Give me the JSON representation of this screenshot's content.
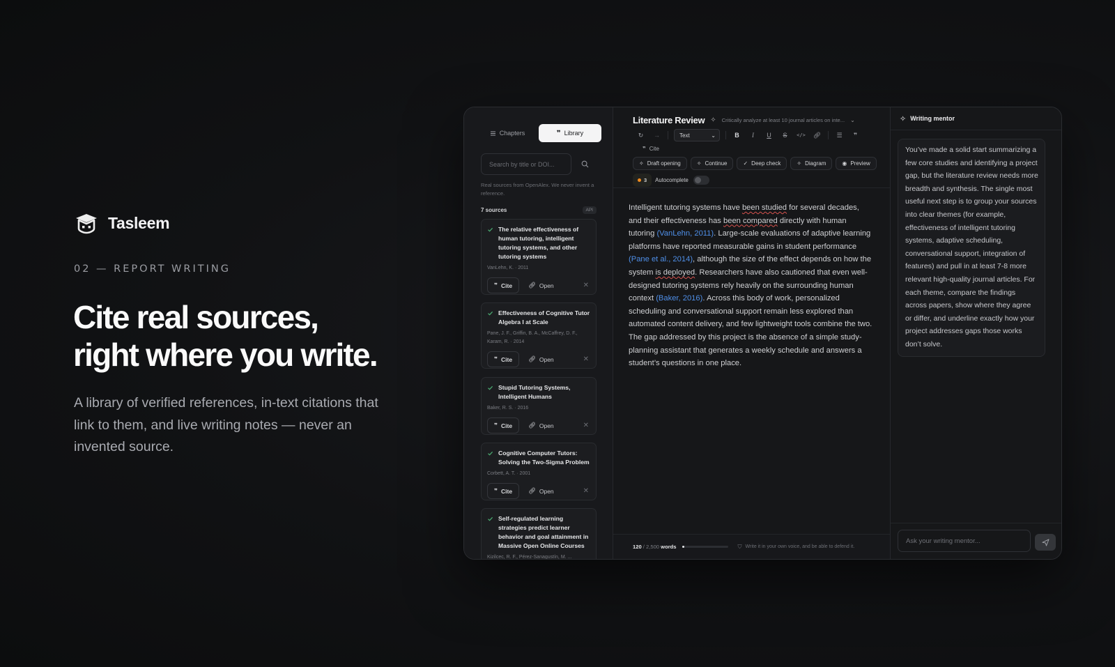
{
  "hero": {
    "brand": "Tasleem",
    "eyebrow": "02 — REPORT WRITING",
    "headline_line1": "Cite real sources,",
    "headline_line2": "right where you write.",
    "lede": "A library of verified references, in-text citations that link to them, and live writing notes — never an invented source."
  },
  "sidebar": {
    "tabs": [
      {
        "label": "Chapters",
        "icon": "list-icon",
        "active": false
      },
      {
        "label": "Library",
        "icon": "quote-icon",
        "active": true
      }
    ],
    "search_placeholder": "Search by title or DOI...",
    "note": "Real sources from OpenAlex. We never invent a reference.",
    "count_label": "7 sources",
    "api_badge": "API",
    "cite_label": "Cite",
    "open_label": "Open",
    "sources": [
      {
        "title": "The relative effectiveness of human tutoring, intelligent tutoring systems, and other tutoring systems",
        "meta": "VanLehn, K. · 2011"
      },
      {
        "title": "Effectiveness of Cognitive Tutor Algebra I at Scale",
        "meta": "Pane, J. F., Griffin, B. A., McCaffrey, D. F., Karam, R. · 2014"
      },
      {
        "title": "Stupid Tutoring Systems, Intelligent Humans",
        "meta": "Baker, R. S. · 2016"
      },
      {
        "title": "Cognitive Computer Tutors: Solving the Two-Sigma Problem",
        "meta": "Corbett, A. T. · 2001"
      },
      {
        "title": "Self-regulated learning strategies predict learner behavior and goal attainment in Massive Open Online Courses",
        "meta": "Kizilcec, R. F., Pérez-Sanagustín, M. ..."
      }
    ]
  },
  "editor": {
    "title": "Literature Review",
    "prompt": "Critically analyze at least 10 journal articles on inte...",
    "format_select": "Text",
    "cite_label": "Cite",
    "chips": [
      "Draft opening",
      "Continue",
      "Deep check",
      "Diagram",
      "Preview"
    ],
    "warning_count": "3",
    "autocomplete_label": "Autocomplete",
    "body": [
      {
        "t": "Intelligent tutoring systems have "
      },
      {
        "t": "been studied",
        "s": "sq"
      },
      {
        "t": " for several decades, and their effectiveness has "
      },
      {
        "t": "been compared",
        "s": "sq"
      },
      {
        "t": " directly with human tutoring "
      },
      {
        "t": "(VanLehn, 2011)",
        "s": "cit"
      },
      {
        "t": ". Large-scale evaluations of adaptive learning platforms have reported measurable gains in student performance "
      },
      {
        "t": "(Pane et al., 2014)",
        "s": "cit"
      },
      {
        "t": ", although the size of the effect depends on how the system "
      },
      {
        "t": "is deployed",
        "s": "sq"
      },
      {
        "t": ". Researchers have also cautioned that even well-designed tutoring systems rely heavily on the surrounding human context "
      },
      {
        "t": "(Baker, 2016)",
        "s": "cit"
      },
      {
        "t": ". Across this body of work, personalized scheduling and conversational support remain less explored than automated content delivery, and few lightweight tools combine the two. The gap addressed by this project is the absence of a simple study-planning assistant that generates a weekly schedule and answers a student’s questions in one place."
      }
    ],
    "word_count": "120",
    "word_total": "/ 2,500",
    "word_unit": "words",
    "word_progress": 0.048,
    "hint": "Write it in your own voice, and be able to defend it."
  },
  "mentor": {
    "title": "Writing mentor",
    "message": "You’ve made a solid start summarizing a few core studies and identifying a project gap, but the literature review needs more breadth and synthesis. The single most useful next step is to group your sources into clear themes (for example, effectiveness of intelligent tutoring systems, adaptive scheduling, conversational support, integration of features) and pull in at least 7-8 more relevant high-quality journal articles. For each theme, compare the findings across papers, show where they agree or differ, and underline exactly how your project addresses gaps those works don’t solve.",
    "input_placeholder": "Ask your writing mentor..."
  },
  "colors": {
    "citation": "#4f8fe8",
    "warning_dot": "#f08a1e",
    "background": "#111214"
  }
}
